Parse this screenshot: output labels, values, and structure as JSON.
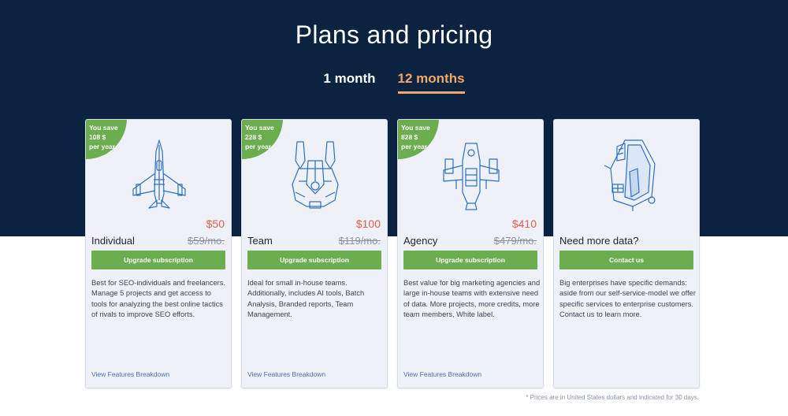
{
  "header": {
    "title": "Plans and pricing",
    "tabs": [
      {
        "label": "1 month",
        "active": false
      },
      {
        "label": "12 months",
        "active": true
      }
    ]
  },
  "colors": {
    "hero_bg": "#0b2240",
    "accent_orange": "#f0a868",
    "green": "#6cad4f",
    "price_red": "#e0604a",
    "illustration_blue": "#2f6fc1"
  },
  "plans": [
    {
      "badge_lines": [
        "You save",
        "108 $",
        "per year"
      ],
      "icon": "fighter-jet-icon",
      "price": "$50",
      "name": "Individual",
      "old_price": "$59/mo.",
      "button_label": "Upgrade subscription",
      "description": "Best for SEO-individuals and freelancers. Manage 5 projects and get access to tools for analyzing the best online tactics of rivals to improve SEO efforts.",
      "link_label": "View Features Breakdown"
    },
    {
      "badge_lines": [
        "You save",
        "228 $",
        "per year"
      ],
      "icon": "starship-icon",
      "price": "$100",
      "name": "Team",
      "old_price": "$119/mo.",
      "button_label": "Upgrade subscription",
      "description": "Ideal for small in-house teams. Additionally, includes AI tools, Batch Analysis, Branded reports, Team Management.",
      "link_label": "View Features Breakdown"
    },
    {
      "badge_lines": [
        "You save",
        "828 $",
        "per year"
      ],
      "icon": "cruiser-ship-icon",
      "price": "$410",
      "name": "Agency",
      "old_price": "$479/mo.",
      "button_label": "Upgrade subscription",
      "description": "Best value for big marketing agencies and large in-house teams with extensive need of data. More projects, more credits, more team members, White label.",
      "link_label": "View Features Breakdown"
    },
    {
      "icon": "mothership-icon",
      "name": "Need more data?",
      "button_label": "Contact us",
      "description": "Big enterprises have specific demands: aside from our self-service-model we offer specific services to enterprise customers. Contact us to learn more."
    }
  ],
  "footnote": "* Prices are in United States dollars and indicated for 30 days."
}
